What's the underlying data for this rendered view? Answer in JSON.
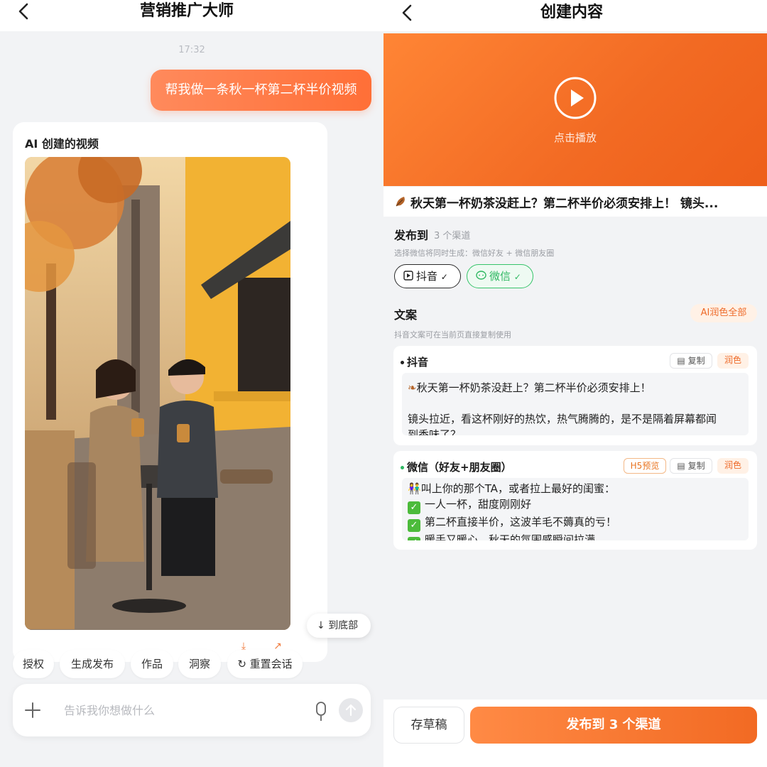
{
  "left": {
    "title": "营销推广大师",
    "timestamp": "17:32",
    "user_message": "帮我做一条秋一杯第二杯半价视频",
    "ai_card_title": "AI 创建的视频",
    "to_bottom_label": "到底部",
    "chips": [
      "授权",
      "生成发布",
      "作品",
      "洞察",
      "重置会话"
    ],
    "input_placeholder": "告诉我你想做什么"
  },
  "right": {
    "title": "创建内容",
    "play_label": "点击播放",
    "video_caption": "秋天第一杯奶茶没赶上？第二杯半价必须安排上！ 镜头...",
    "publish_to": {
      "label": "发布到",
      "count": "3 个渠道",
      "hint": "选择微信将同时生成：微信好友 + 微信朋友圈",
      "channels": [
        "抖音",
        "微信"
      ]
    },
    "copywriting": {
      "label": "文案",
      "polish_all": "AI润色全部",
      "hint": "抖音文案可在当前页直接复制使用"
    },
    "douyin_card": {
      "title": "抖音",
      "copy": "复制",
      "polish": "润色",
      "lines": [
        "秋天第一杯奶茶没赶上？第二杯半价必须安排上！",
        "",
        "镜头拉近，看这杯刚好的热饮，热气腾腾的，是不是隔着屏幕都闻",
        "到香味了？"
      ]
    },
    "wechat_card": {
      "title": "微信（好友+朋友圈）",
      "h5": "H5预览",
      "copy": "复制",
      "polish": "润色",
      "intro": "叫上你的那个TA，或者拉上最好的闺蜜：",
      "bullets": [
        "一人一杯，甜度刚刚好",
        "第二杯直接半价，这波羊毛不薅真的亏！",
        "暖手又暖心，秋天的氛围感瞬间拉满"
      ]
    },
    "save_draft": "存草稿",
    "publish_button": "发布到 3 个渠道"
  },
  "colors": {
    "accent": "#f26a23",
    "wechat_green": "#36c46a",
    "check_green": "#4cbb3b"
  }
}
